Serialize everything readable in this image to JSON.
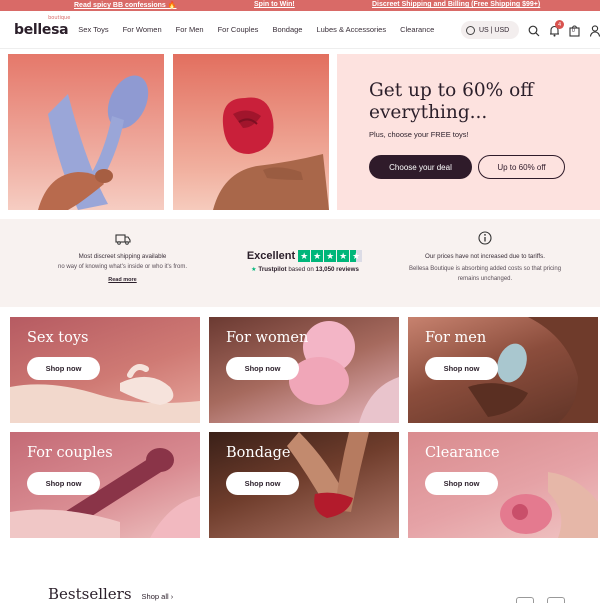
{
  "announcement": {
    "items": [
      "Read spicy BB confessions 🔥",
      "Spin to Win!",
      "Discreet Shipping and Billing (Free Shipping $99+)"
    ]
  },
  "header": {
    "logo": "bellesa",
    "logo_tag": "boutique",
    "nav": [
      "Sex Toys",
      "For Women",
      "For Men",
      "For Couples",
      "Bondage",
      "Lubes & Accessories",
      "Clearance"
    ],
    "currency": "US | USD",
    "notification_count": "4",
    "cart_count": "0"
  },
  "hero": {
    "title": "Get up to 60% off everything...",
    "subtitle": "Plus, choose your FREE toys!",
    "primary_button": "Choose your deal",
    "secondary_button": "Up to 60% off"
  },
  "trust": {
    "shipping_title": "Most discreet shipping available",
    "shipping_sub": "no way of knowing what's inside or who it's from.",
    "shipping_link": "Read more",
    "rating_label": "Excellent",
    "rating_stars": 4.5,
    "trustpilot": "Trustpilot",
    "reviews_prefix": "based on",
    "reviews_count": "13,050 reviews",
    "prices_title": "Our prices have not increased due to tariffs.",
    "prices_sub": "Bellesa Boutique is absorbing added costs so that pricing remains unchanged."
  },
  "categories": [
    {
      "label": "Sex toys",
      "button": "Shop now"
    },
    {
      "label": "For women",
      "button": "Shop now"
    },
    {
      "label": "For men",
      "button": "Shop now"
    },
    {
      "label": "For couples",
      "button": "Shop now"
    },
    {
      "label": "Bondage",
      "button": "Shop now"
    },
    {
      "label": "Clearance",
      "button": "Shop now"
    }
  ],
  "bestsellers": {
    "title": "Bestsellers",
    "shop_all": "Shop all"
  },
  "colors": {
    "brand": "#d96a67",
    "dark": "#2f1b2a",
    "hero_panel": "#fde2df",
    "trustpilot_green": "#00b67a"
  }
}
